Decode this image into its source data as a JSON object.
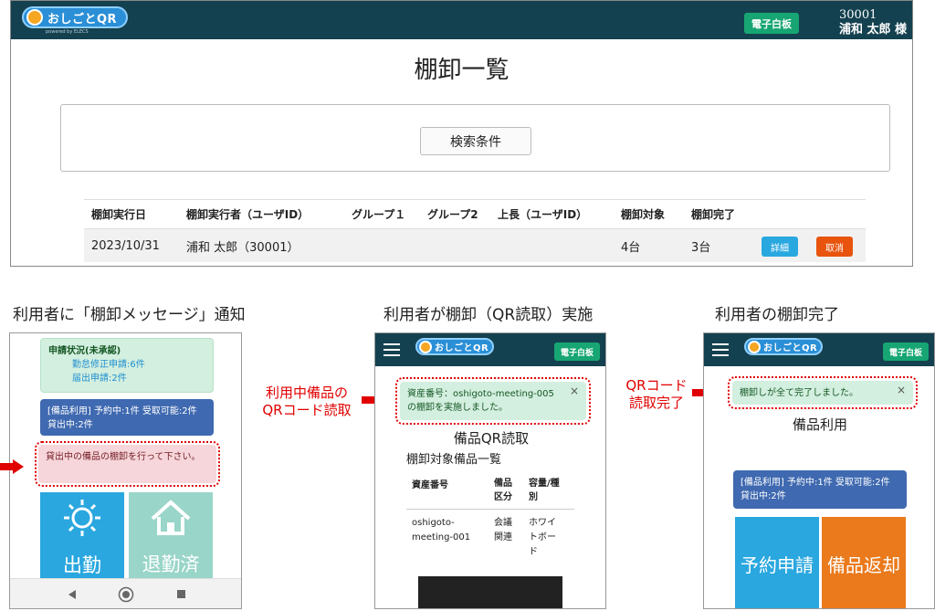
{
  "main": {
    "logo": "おしごとQR",
    "logo_sub": "powered by ELECS",
    "board_button": "電子白板",
    "user_id": "30001",
    "user_name": "浦和 太郎 様",
    "page_title": "棚卸一覧",
    "search_button": "検索条件",
    "columns": [
      "棚卸実行日",
      "棚卸実行者（ユーザID）",
      "グループ１",
      "グループ2",
      "上長（ユーザID）",
      "棚卸対象",
      "棚卸完了"
    ],
    "row": {
      "date": "2023/10/31",
      "executor": "浦和 太郎（30001）",
      "target": "4台",
      "done": "3台",
      "detail_button": "詳細",
      "cancel_button": "取消"
    },
    "colors": {
      "header": "#14414f",
      "board": "#17a673",
      "detail": "#29a8e0",
      "cancel": "#e8540e"
    }
  },
  "captions": {
    "left": "利用者に「棚卸メッセージ」通知",
    "middle": "利用者が棚卸（QR読取）実施",
    "right": "利用者の棚卸完了"
  },
  "labels": {
    "middle_red": "利用中備品の\nQRコード読取",
    "right_red": "QRコード\n読取完了"
  },
  "phone1": {
    "status_title": "申請状況(未承認)",
    "status_line1": "勤怠修正申請:6件",
    "status_line2": "届出申請:2件",
    "equip_line1": "[備品利用] 予約中:1件 受取可能:2件",
    "equip_line2": "貸出中:2件",
    "message": "貸出中の備品の棚卸を行って下さい。",
    "tile_in": "出勤",
    "tile_out": "退勤済",
    "icons": [
      "back-icon",
      "home-circle-icon",
      "recent-square-icon"
    ]
  },
  "phone2": {
    "board_button": "電子白板",
    "alert_line1": "資産番号：oshigoto-meeting-005",
    "alert_line2": "の棚卸を実施しました。",
    "close": "×",
    "title": "備品QR読取",
    "subtitle": "棚卸対象備品一覧",
    "th": [
      "資産番号",
      "備品\n区分",
      "容量/種\n別"
    ],
    "td": [
      "oshigoto-\nmeeting-001",
      "会議\n関連",
      "ホワイ\nトボー\nド"
    ]
  },
  "phone3": {
    "board_button": "電子白板",
    "alert": "棚卸しが全て完了しました。",
    "close": "×",
    "title": "備品利用",
    "equip_line1": "[備品利用] 予約中:1件 受取可能:2件",
    "equip_line2": "貸出中:2件",
    "tile_reserve": "予約申請",
    "tile_return": "備品返却"
  }
}
